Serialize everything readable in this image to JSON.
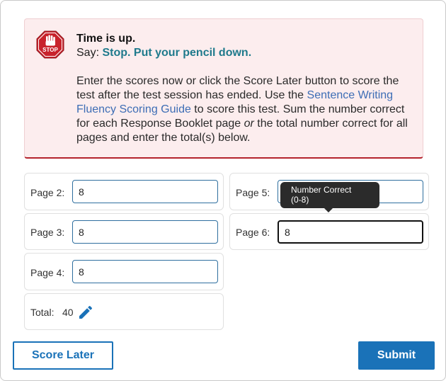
{
  "alert": {
    "title": "Time is up.",
    "say_label": "Say:",
    "say_text": "Stop. Put your pencil down.",
    "body_before_link": "Enter the scores now or click the Score Later button to score the test after the test session has ended. Use the ",
    "link_text": "Sentence Writing Fluency Scoring Guide",
    "body_after_link": "  to score this test. Sum the number correct for each Response Booklet page ",
    "body_italic": "or",
    "body_end": " the total number correct for all pages and enter the total(s) below.",
    "icon": "stop-sign-hand-icon",
    "icon_text": "STOP"
  },
  "fields": {
    "page2": {
      "label": "Page 2:",
      "value": "8"
    },
    "page3": {
      "label": "Page 3:",
      "value": "8"
    },
    "page4": {
      "label": "Page 4:",
      "value": "8"
    },
    "page5": {
      "label": "Page 5:",
      "value": ""
    },
    "page6": {
      "label": "Page 6:",
      "value": "8"
    }
  },
  "total": {
    "label": "Total:",
    "value": "40",
    "icon": "pencil-edit-icon"
  },
  "tooltip": {
    "line1": "Number Correct",
    "line2": "(0-8)"
  },
  "buttons": {
    "score_later": "Score Later",
    "submit": "Submit"
  },
  "colors": {
    "accent": "#1a72b8",
    "alert_bg": "#fcedee",
    "alert_border": "#b4232c",
    "say_text": "#1f7a8c",
    "link": "#3d6db5",
    "stop_red": "#c8232c"
  }
}
